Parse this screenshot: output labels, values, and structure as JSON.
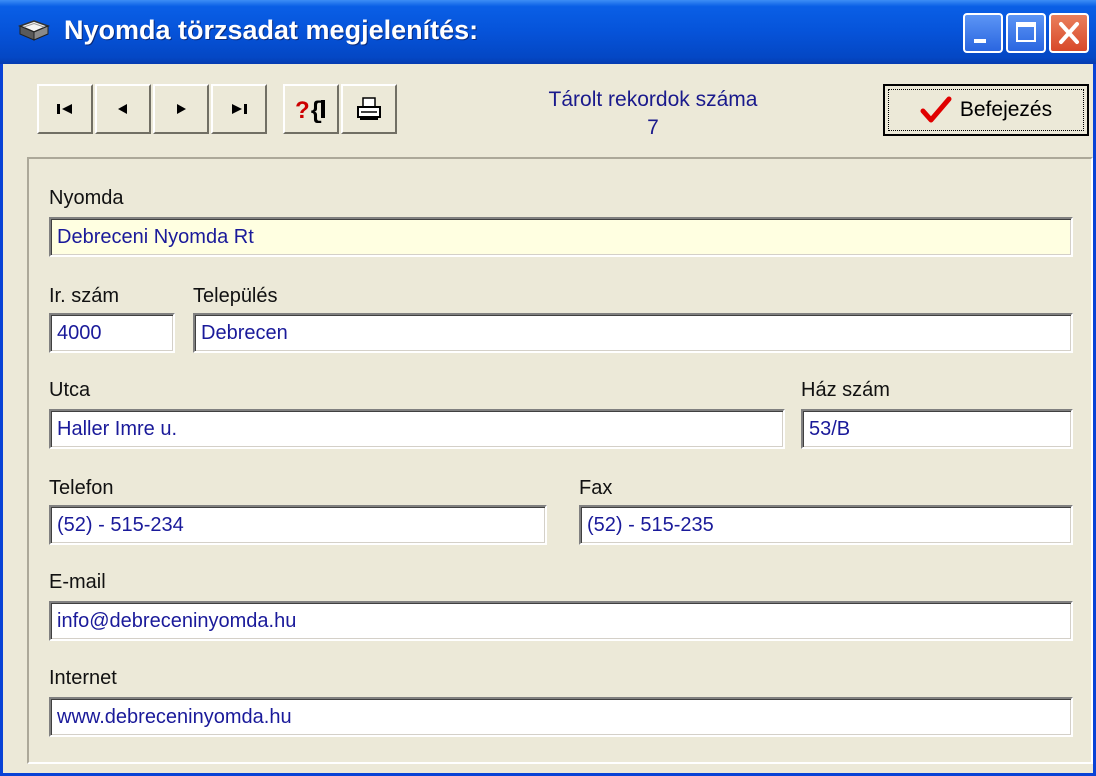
{
  "window": {
    "title": "Nyomda törzsadat megjelenítés:"
  },
  "toolbar": {
    "buttons": [
      "first-record",
      "previous-record",
      "next-record",
      "last-record",
      "search",
      "print"
    ],
    "record_count_label": "Tárolt rekordok száma",
    "record_count": "7",
    "finish_label": "Befejezés"
  },
  "form": {
    "nyomda": {
      "label": "Nyomda",
      "value": "Debreceni Nyomda Rt"
    },
    "irszam": {
      "label": "Ir. szám",
      "value": "4000"
    },
    "telepules": {
      "label": "Település",
      "value": "Debrecen"
    },
    "utca": {
      "label": "Utca",
      "value": "Haller Imre u."
    },
    "hazszam": {
      "label": "Ház szám",
      "value": "53/B"
    },
    "telefon": {
      "label": "Telefon",
      "value": "(52) - 515-234"
    },
    "fax": {
      "label": "Fax",
      "value": "(52) - 515-235"
    },
    "email": {
      "label": "E-mail",
      "value": "info@debreceninyomda.hu"
    },
    "internet": {
      "label": "Internet",
      "value": "www.debreceninyomda.hu"
    }
  },
  "colors": {
    "titlebar": "#0653d9",
    "field_text": "#1a1a9a",
    "active_field": "#ffffe1",
    "window_bg": "#ece9d8"
  }
}
